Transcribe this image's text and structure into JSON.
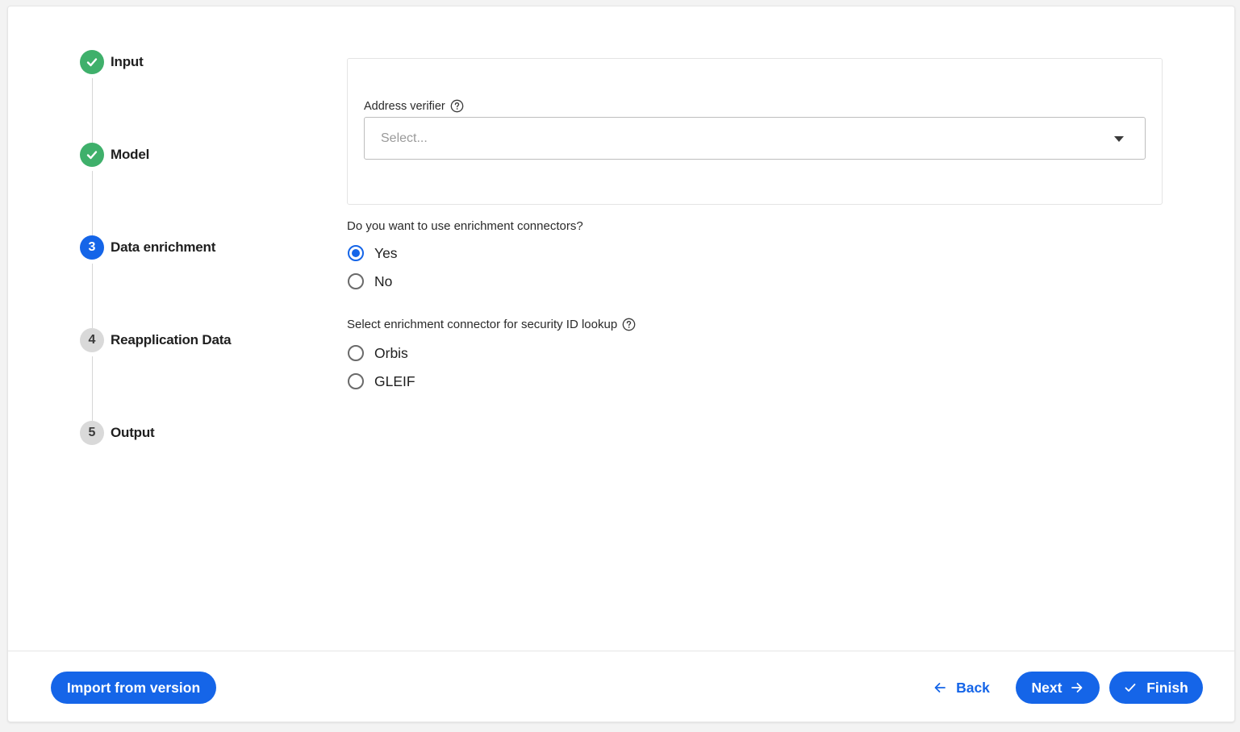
{
  "stepper": {
    "steps": [
      {
        "label": "Input",
        "number": "1",
        "status": "done"
      },
      {
        "label": "Model",
        "number": "2",
        "status": "done"
      },
      {
        "label": "Data enrichment",
        "number": "3",
        "status": "active"
      },
      {
        "label": "Reapplication Data",
        "number": "4",
        "status": "pending"
      },
      {
        "label": "Output",
        "number": "5",
        "status": "pending"
      }
    ]
  },
  "address": {
    "label": "Address verifier",
    "placeholder": "Select..."
  },
  "enrichment": {
    "question": "Do you want to use enrichment connectors?",
    "options": [
      {
        "label": "Yes",
        "checked": true
      },
      {
        "label": "No",
        "checked": false
      }
    ]
  },
  "security_lookup": {
    "question": "Select enrichment connector for security ID lookup",
    "options": [
      {
        "label": "Orbis",
        "checked": false
      },
      {
        "label": "GLEIF",
        "checked": false
      }
    ]
  },
  "footer": {
    "import_label": "Import from version",
    "back_label": "Back",
    "next_label": "Next",
    "finish_label": "Finish"
  },
  "colors": {
    "accent": "#1565e8",
    "success": "#3fb06b",
    "pending": "#d9d9d9"
  },
  "icons": {
    "done": "check-icon",
    "help": "help-circle-icon",
    "back": "arrow-left-icon",
    "next": "arrow-right-icon",
    "finish": "check-icon"
  }
}
